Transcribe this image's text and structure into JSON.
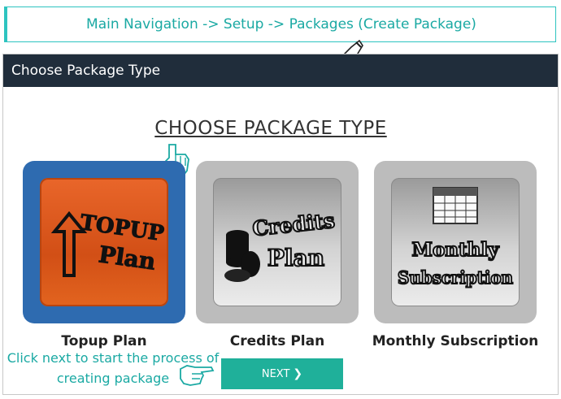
{
  "breadcrumb": "Main Navigation -> Setup -> Packages (Create Package)",
  "panel": {
    "title": "Choose Package Type",
    "heading": "CHOOSE PACKAGE TYPE"
  },
  "packages": [
    {
      "label": "Topup Plan",
      "art_line1": "TOPUP",
      "art_line2": "Plan",
      "selected": true
    },
    {
      "label": "Credits Plan",
      "art_line1": "Credits",
      "art_line2": "Plan",
      "selected": false
    },
    {
      "label": "Monthly Subscription",
      "art_line1": "Monthly",
      "art_line2": "Subscription",
      "selected": false
    }
  ],
  "hint_text": "Click next to start the process of creating package",
  "next_button": {
    "label": "NEXT",
    "icon": "chevron-right-icon"
  },
  "colors": {
    "accent_teal": "#1aa9a3",
    "button_green": "#1fb09a",
    "header_dark": "#202d3b",
    "selected_blue": "#2e6bb0",
    "topup_orange": "#d24f16"
  }
}
